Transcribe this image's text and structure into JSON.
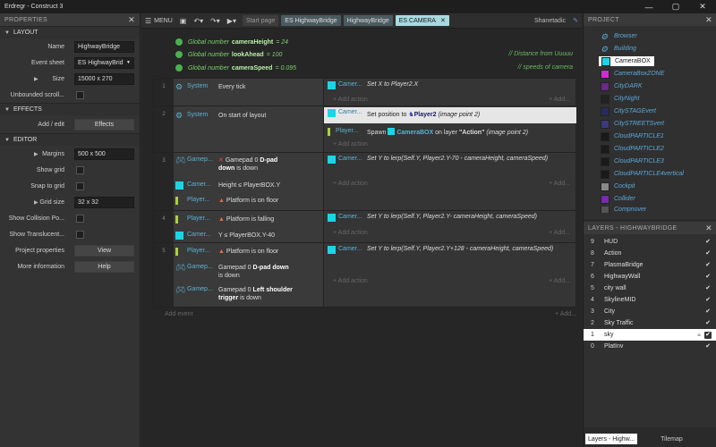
{
  "window": {
    "title": "Erdregr - Construct 3"
  },
  "properties": {
    "title": "PROPERTIES",
    "sections": {
      "layout": "LAYOUT",
      "effects": "EFFECTS",
      "editor": "EDITOR"
    },
    "name_label": "Name",
    "name_value": "HighwayBridge",
    "eventsheet_label": "Event sheet",
    "eventsheet_value": "ES HighwayBrid",
    "size_label": "Size",
    "size_value": "15000 x 270",
    "unbounded_label": "Unbounded scroll...",
    "addedit_label": "Add / edit",
    "effects_button": "Effects",
    "margins_label": "Margins",
    "margins_value": "500 x 500",
    "showgrid_label": "Show grid",
    "snapgrid_label": "Snap to grid",
    "gridsize_label": "Grid size",
    "gridsize_value": "32 x 32",
    "showcollision_label": "Show Collision Po...",
    "showtranslucent_label": "Show Translucent...",
    "projprops_label": "Project properties",
    "view_button": "View",
    "moreinfo_label": "More information",
    "help_button": "Help"
  },
  "toolbar": {
    "menu": "MENU",
    "tabs": [
      "Start page",
      "ES HighwayBridge",
      "HighwayBridge",
      "ES CAMERA"
    ],
    "user": "Shanetadic"
  },
  "globals": [
    {
      "prefix": "Global number",
      "name": "cameraHeight",
      "value": "= 24",
      "comment": ""
    },
    {
      "prefix": "Global number",
      "name": "lookAhead",
      "value": "= 100",
      "comment": "// Distance from Uuuuu"
    },
    {
      "prefix": "Global number",
      "name": "cameraSpeed",
      "value": "= 0.095",
      "comment": "// speeds of camera"
    }
  ],
  "events": {
    "e1": {
      "num": "1",
      "cond_obj": "System",
      "cond_text": "Every tick",
      "act_obj": "Camer...",
      "act_text": "Set X to Player2.X"
    },
    "e2": {
      "num": "2",
      "cond_obj": "System",
      "cond_text": "On start of layout",
      "act1_obj": "Camer...",
      "act1_pre": "Set position to",
      "act1_target": "Player2",
      "act1_post": "(image point 2)",
      "act2_obj": "Player...",
      "act2_pre": "Spawn",
      "act2_target": "CameraBOX",
      "act2_mid": "on layer",
      "act2_layer": "\"Action\"",
      "act2_post": "(image point 2)"
    },
    "e3": {
      "num": "3",
      "c1_obj": "Gamep...",
      "c1_pre": "Gamepad 0",
      "c1_bold": "D-pad",
      "c1_line2": "down",
      "c1_post": "is down",
      "c2_obj": "Camer...",
      "c2_text": "Height ≤ PlayerBOX.Y",
      "c3_obj": "Player...",
      "c3_text": "Platform is on floor",
      "act_obj": "Camer...",
      "act_text": "Set Y to lerp(Self.Y, Player2.Y-70 - cameraHeight, cameraSpeed)"
    },
    "e4": {
      "num": "4",
      "c1_obj": "Player...",
      "c1_text": "Platform is falling",
      "c2_obj": "Camer...",
      "c2_text": "Y ≤ PlayerBOX.Y-40",
      "act_obj": "Camer...",
      "act_text": "Set Y to lerp(Self.Y, Player2.Y- cameraHeight, cameraSpeed)"
    },
    "e5": {
      "num": "5",
      "c1_obj": "Player...",
      "c1_text": "Platform is on floor",
      "c2_obj": "Gamep...",
      "c2_pre": "Gamepad 0",
      "c2_bold": "D-pad down",
      "c2_post": "is down",
      "c3_obj": "Gamep...",
      "c3_pre": "Gamepad 0",
      "c3_bold": "Left shoulder trigger",
      "c3_post": "is down",
      "act_obj": "Camer...",
      "act_text": "Set Y to lerp(Self.Y, Player2.Y+128 - cameraHeight, cameraSpeed)"
    },
    "add_action": "+ Add action",
    "add_action_short": "+ Add...",
    "add_event": "Add event"
  },
  "project": {
    "title": "PROJECT",
    "items": [
      "Browser",
      "Building",
      "CameraBOX",
      "CameraBoxZONE",
      "CityDARK",
      "CityNight",
      "CitySTAGEvert",
      "CitySTREETSvert",
      "CloudPARTICLE1",
      "CloudPARTICLE2",
      "CloudPARTICLE3",
      "CloudPARTICLE4vertical",
      "Cockpit",
      "Collider",
      "Compnover"
    ]
  },
  "layers": {
    "title": "LAYERS - HIGHWAYBRIDGE",
    "rows": [
      {
        "num": "9",
        "name": "HUD"
      },
      {
        "num": "8",
        "name": "Action"
      },
      {
        "num": "7",
        "name": "PlasmaBridge"
      },
      {
        "num": "6",
        "name": "HighwayWall"
      },
      {
        "num": "5",
        "name": "city wall"
      },
      {
        "num": "4",
        "name": "SkylineMID"
      },
      {
        "num": "3",
        "name": "City"
      },
      {
        "num": "2",
        "name": "Sky Traffic"
      },
      {
        "num": "1",
        "name": "sky"
      },
      {
        "num": "0",
        "name": "PlatInv"
      }
    ],
    "tab1": "Layers - Highw...",
    "tab2": "Tilemap"
  },
  "colors": {
    "accent": "#a8d9e0",
    "object": "#19d6e6",
    "global": "#7ccf6c"
  }
}
